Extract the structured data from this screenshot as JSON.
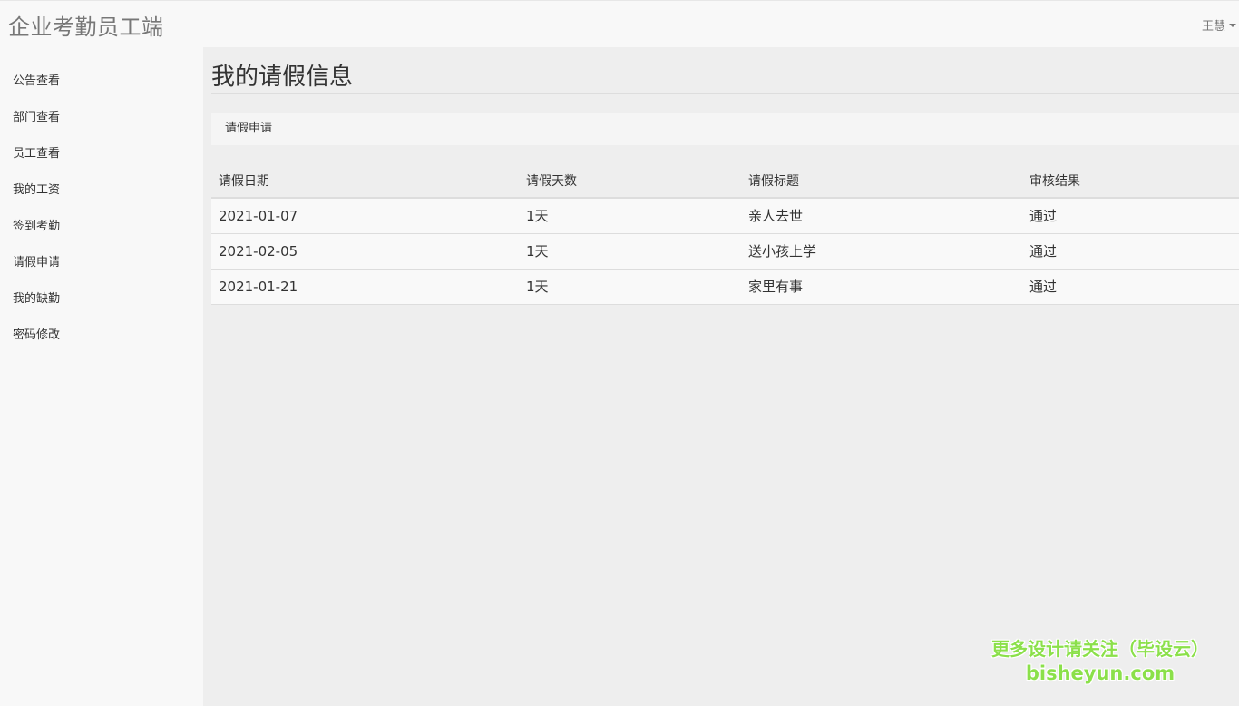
{
  "app": {
    "title": "企业考勤员工端",
    "user_name": "王慧"
  },
  "sidebar": {
    "items": [
      {
        "label": "公告查看"
      },
      {
        "label": "部门查看"
      },
      {
        "label": "员工查看"
      },
      {
        "label": "我的工资"
      },
      {
        "label": "签到考勤"
      },
      {
        "label": "请假申请"
      },
      {
        "label": "我的缺勤"
      },
      {
        "label": "密码修改"
      }
    ]
  },
  "main": {
    "page_title": "我的请假信息",
    "breadcrumb_link": "请假申请",
    "table": {
      "headers": [
        "请假日期",
        "请假天数",
        "请假标题",
        "审核结果"
      ],
      "rows": [
        [
          "2021-01-07",
          "1天",
          "亲人去世",
          "通过"
        ],
        [
          "2021-02-05",
          "1天",
          "送小孩上学",
          "通过"
        ],
        [
          "2021-01-21",
          "1天",
          "家里有事",
          "通过"
        ]
      ]
    }
  },
  "watermark": {
    "line1": "更多设计请关注（毕设云）",
    "line2": "bisheyun.com"
  }
}
